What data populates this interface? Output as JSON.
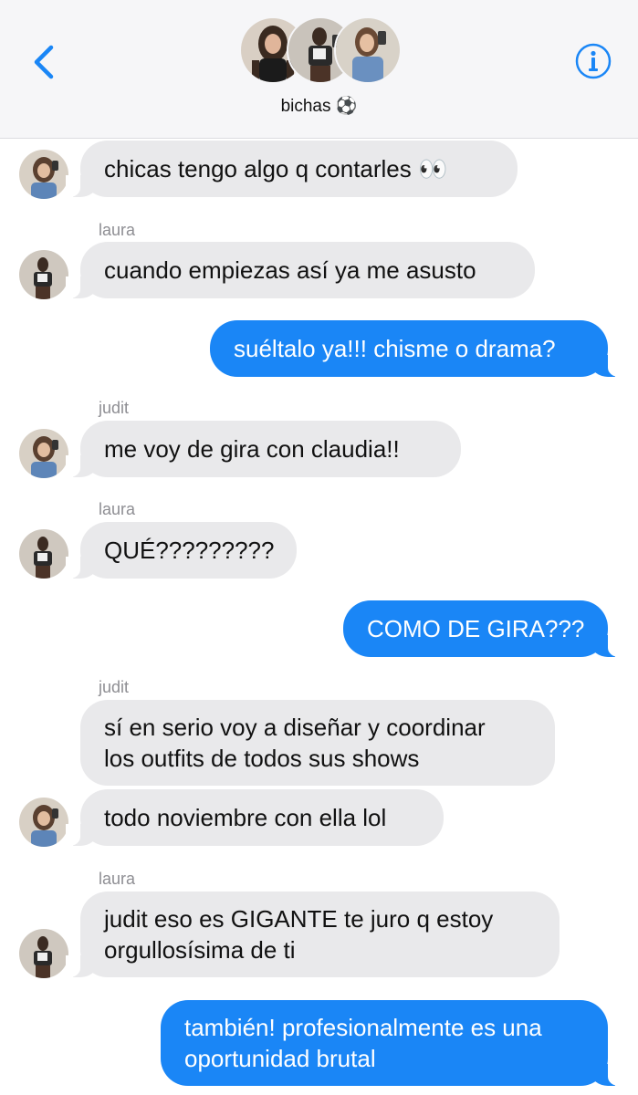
{
  "header": {
    "group_name": "bichas",
    "group_emoji": "⚽",
    "back_icon": "chevron-left-icon",
    "info_icon": "info-circle-icon",
    "accent_color": "#1a86f6"
  },
  "messages": [
    {
      "direction": "incoming",
      "sender": "",
      "text": "chicas tengo algo q contarles 👀"
    },
    {
      "direction": "incoming",
      "sender": "laura",
      "text": "cuando empiezas así ya me asusto"
    },
    {
      "direction": "outgoing",
      "sender": "",
      "text": "suéltalo ya!!! chisme o drama?"
    },
    {
      "direction": "incoming",
      "sender": "judit",
      "text": "me voy de gira con claudia!!"
    },
    {
      "direction": "incoming",
      "sender": "laura",
      "text": "QUÉ?????????"
    },
    {
      "direction": "outgoing",
      "sender": "",
      "text": "COMO DE GIRA???"
    },
    {
      "direction": "incoming",
      "sender": "judit",
      "lines": [
        "sí en serio voy a diseñar y coordinar",
        "los outfits de todos sus shows"
      ]
    },
    {
      "direction": "incoming",
      "sender": "",
      "text": "todo noviembre con ella lol"
    },
    {
      "direction": "incoming",
      "sender": "laura",
      "lines": [
        "judit eso es GIGANTE te juro q estoy",
        "orgullosísima de ti"
      ]
    },
    {
      "direction": "outgoing",
      "sender": "",
      "lines": [
        "también! profesionalmente es una",
        "oportunidad brutal"
      ]
    }
  ]
}
